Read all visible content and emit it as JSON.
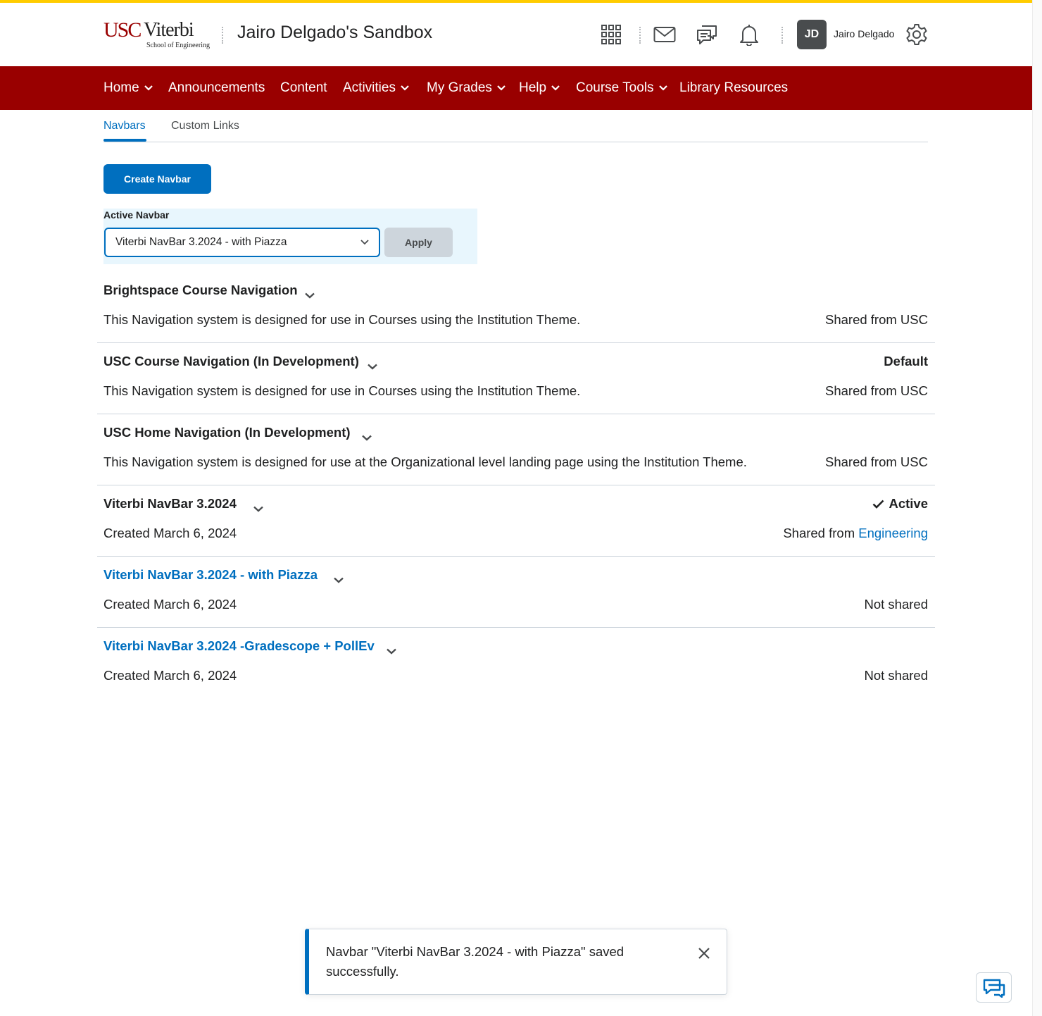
{
  "header": {
    "logo": {
      "usc": "USC",
      "viterbi": "Viterbi",
      "school": "School of Engineering"
    },
    "course_title": "Jairo Delgado's Sandbox",
    "user_initials": "JD",
    "user_name": "Jairo Delgado",
    "icons": [
      "waffle-grid-icon",
      "mail-icon",
      "discussions-icon",
      "bell-icon",
      "gear-icon"
    ]
  },
  "nav": {
    "items": [
      {
        "label": "Home",
        "has_menu": true
      },
      {
        "label": "Announcements",
        "has_menu": false
      },
      {
        "label": "Content",
        "has_menu": false
      },
      {
        "label": "Activities",
        "has_menu": true
      },
      {
        "label": "My Grades",
        "has_menu": true
      },
      {
        "label": "Help",
        "has_menu": true
      },
      {
        "label": "Course Tools",
        "has_menu": true
      },
      {
        "label": "Library Resources",
        "has_menu": false
      }
    ]
  },
  "tabs": {
    "navbars": "Navbars",
    "custom_links": "Custom Links",
    "selected": "Navbars"
  },
  "create_button": "Create Navbar",
  "active_navbar": {
    "label": "Active Navbar",
    "selected": "Viterbi NavBar 3.2024 - with Piazza",
    "apply": "Apply"
  },
  "navbars": [
    {
      "title": "Brightspace Course Navigation",
      "is_link": false,
      "status": "",
      "description": "This Navigation system is designed for use in Courses using the Institution Theme.",
      "sharing": "Shared from USC",
      "sharing_prefix": "",
      "sharing_link": ""
    },
    {
      "title": "USC Course Navigation (In Development)",
      "is_link": false,
      "status": "Default",
      "description": "This Navigation system is designed for use in Courses using the Institution Theme.",
      "sharing": "Shared from USC",
      "sharing_prefix": "",
      "sharing_link": ""
    },
    {
      "title": "USC Home Navigation (In Development)",
      "is_link": false,
      "status": "",
      "description": "This Navigation system is designed for use at the Organizational level landing page using the Institution Theme.",
      "sharing": "Shared from USC",
      "sharing_prefix": "",
      "sharing_link": ""
    },
    {
      "title": "Viterbi NavBar 3.2024",
      "is_link": false,
      "status": "Active",
      "description": "Created March 6, 2024",
      "sharing": "",
      "sharing_prefix": "Shared from ",
      "sharing_link": "Engineering"
    },
    {
      "title": "Viterbi NavBar 3.2024 - with Piazza",
      "is_link": true,
      "status": "",
      "description": "Created March 6, 2024",
      "sharing": "Not shared",
      "sharing_prefix": "",
      "sharing_link": ""
    },
    {
      "title": "Viterbi NavBar 3.2024 -Gradescope + PollEv",
      "is_link": true,
      "status": "",
      "description": "Created March 6, 2024",
      "sharing": "Not shared",
      "sharing_prefix": "",
      "sharing_link": ""
    }
  ],
  "toast": {
    "message": "Navbar \"Viterbi NavBar 3.2024 - with Piazza\" saved successfully."
  },
  "colors": {
    "brand_red": "#990000",
    "accent_blue": "#006fbf",
    "top_stripe": "#ffcc00"
  }
}
